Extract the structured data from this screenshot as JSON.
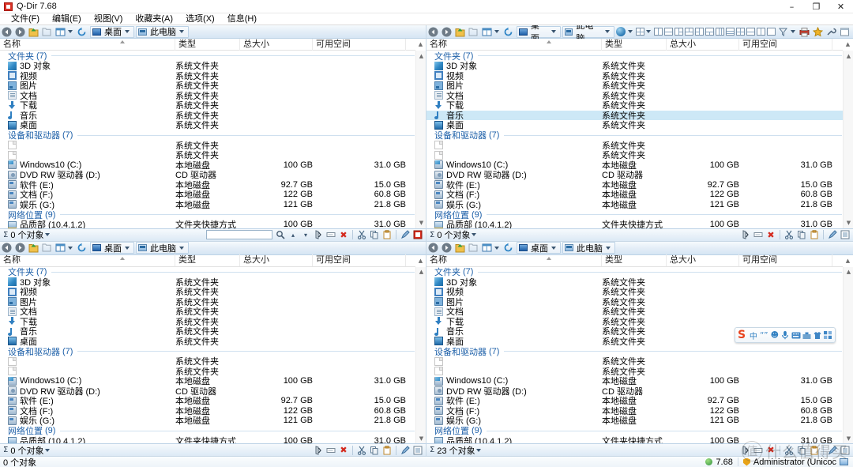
{
  "window": {
    "title": "Q-Dir 7.68",
    "app_icon": "qdir-icon",
    "minimize": "–",
    "maximize": "❐",
    "close": "✕"
  },
  "menubar": {
    "items": [
      {
        "label": "文件(F)",
        "name": "menu-file"
      },
      {
        "label": "编辑(E)",
        "name": "menu-edit"
      },
      {
        "label": "视图(V)",
        "name": "menu-view"
      },
      {
        "label": "收藏夹(A)",
        "name": "menu-favorites"
      },
      {
        "label": "选项(X)",
        "name": "menu-options"
      },
      {
        "label": "信息(H)",
        "name": "menu-info"
      }
    ]
  },
  "address_bar": {
    "back": "◀",
    "forward": "▶",
    "up": "↑",
    "crumb_desktop": "桌面",
    "crumb_computer": "此电脑",
    "refresh_icon": "refresh-icon",
    "dropdown_caret": "▾"
  },
  "columns": {
    "name": "名称",
    "type": "类型",
    "total_size": "总大小",
    "free_space": "可用空间"
  },
  "groups": {
    "folders": {
      "label": "文件夹",
      "count": "(7)"
    },
    "drives": {
      "label": "设备和驱动器",
      "count": "(7)"
    },
    "network": {
      "label": "网络位置",
      "count": "(9)"
    }
  },
  "folders": [
    {
      "name": "3D 对象",
      "type": "系统文件夹",
      "size": "",
      "free": "",
      "icon": "cube"
    },
    {
      "name": "视频",
      "type": "系统文件夹",
      "size": "",
      "free": "",
      "icon": "video"
    },
    {
      "name": "图片",
      "type": "系统文件夹",
      "size": "",
      "free": "",
      "icon": "pic"
    },
    {
      "name": "文档",
      "type": "系统文件夹",
      "size": "",
      "free": "",
      "icon": "doc"
    },
    {
      "name": "下载",
      "type": "系统文件夹",
      "size": "",
      "free": "",
      "icon": "dl"
    },
    {
      "name": "音乐",
      "type": "系统文件夹",
      "size": "",
      "free": "",
      "icon": "music"
    },
    {
      "name": "桌面",
      "type": "系统文件夹",
      "size": "",
      "free": "",
      "icon": "desk"
    }
  ],
  "drives": [
    {
      "name": "",
      "type": "系统文件夹",
      "size": "",
      "free": "",
      "icon": "blank"
    },
    {
      "name": "",
      "type": "系统文件夹",
      "size": "",
      "free": "",
      "icon": "blank"
    },
    {
      "name": "Windows10 (C:)",
      "type": "本地磁盘",
      "size": "100 GB",
      "free": "31.0 GB",
      "icon": "hddwin"
    },
    {
      "name": "DVD RW 驱动器 (D:)",
      "type": "CD 驱动器",
      "size": "",
      "free": "",
      "icon": "cd"
    },
    {
      "name": "软件 (E:)",
      "type": "本地磁盘",
      "size": "92.7 GB",
      "free": "15.0 GB",
      "icon": "hdd"
    },
    {
      "name": "文档 (F:)",
      "type": "本地磁盘",
      "size": "122 GB",
      "free": "60.8 GB",
      "icon": "hdd"
    },
    {
      "name": "娱乐 (G:)",
      "type": "本地磁盘",
      "size": "121 GB",
      "free": "21.8 GB",
      "icon": "hdd"
    }
  ],
  "network": [
    {
      "name": "品质部 (10.4.1.2)",
      "type": "文件夹快捷方式",
      "size": "100 GB",
      "free": "31.0 GB",
      "icon": "netsc"
    }
  ],
  "selection": {
    "pane2_selected_row_index": 5
  },
  "pane_status": {
    "pane1": {
      "count": "0 个对象",
      "search_placeholder": ""
    },
    "pane2": {
      "count": "0 个对象",
      "search_placeholder": ""
    },
    "pane3": {
      "count": "0 个对象",
      "search_placeholder": ""
    },
    "pane4": {
      "count": "23 个对象",
      "search_placeholder": ""
    }
  },
  "status_icons": {
    "search": "search-icon",
    "prev": "▴",
    "next": "▾",
    "zip": "zip-icon",
    "rename": "rename-icon",
    "delete": "✖",
    "cut": "cut-icon",
    "copy": "copy-icon",
    "paste": "paste-icon",
    "edit": "edit-icon",
    "properties": "properties-icon"
  },
  "app_status": {
    "version": "7.68",
    "user": "Administrator (Unicoc"
  },
  "ime": {
    "logo": "S",
    "mode_cn": "中",
    "punctuation": "“”",
    "emoji": "☻",
    "mic": "☩",
    "keyboard": "keyboard-icon",
    "toolbox": "toolbox-icon",
    "skin": "skin-icon",
    "apps": "apps-icon"
  },
  "watermark": {
    "mark": "值",
    "text": "什么值得买"
  }
}
